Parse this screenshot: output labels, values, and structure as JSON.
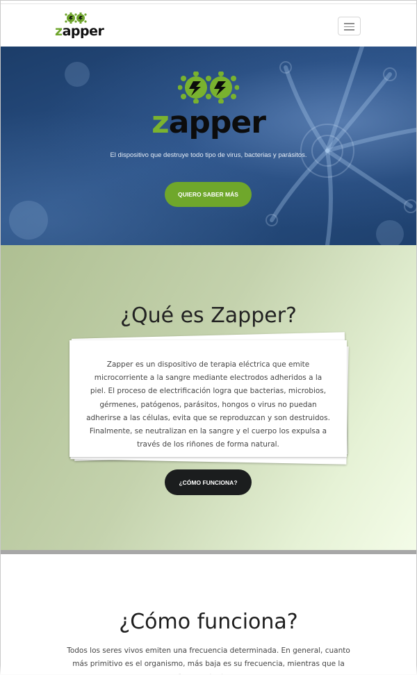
{
  "navbar": {
    "logo_z": "z",
    "logo_rest": "apper",
    "menu_icon": "hamburger-menu-icon"
  },
  "hero": {
    "logo_z": "z",
    "logo_rest": "apper",
    "tagline": "El dispositivo que destruye todo tipo de virus, bacterias y parásitos.",
    "cta_label": "QUIERO SABER MÁS"
  },
  "que_es": {
    "title": "¿Qué es Zapper?",
    "body": "Zapper es un dispositivo de terapia eléctrica que emite microcorriente a la sangre mediante electrodos adheridos a la piel. El proceso de electrificación logra que bacterias, microbios, gérmenes, patógenos, parásitos, hongos o virus no puedan adherirse a las células, evita que se reproduzcan y son destruidos. Finalmente, se neutralizan en la sangre y el cuerpo los expulsa a través de los riñones de forma natural.",
    "cta_label": "¿CÓMO FUNCIONA?"
  },
  "como_funciona": {
    "title": "¿Cómo funciona?",
    "body": "Todos los seres vivos emiten una frecuencia determinada. En general, cuanto más primitivo es el organismo, más baja es su frecuencia, mientras que la frecuencia de un"
  },
  "colors": {
    "brand_green": "#6fa72b",
    "hero_blue": "#244a7c",
    "dark_button": "#1b1d1e"
  }
}
